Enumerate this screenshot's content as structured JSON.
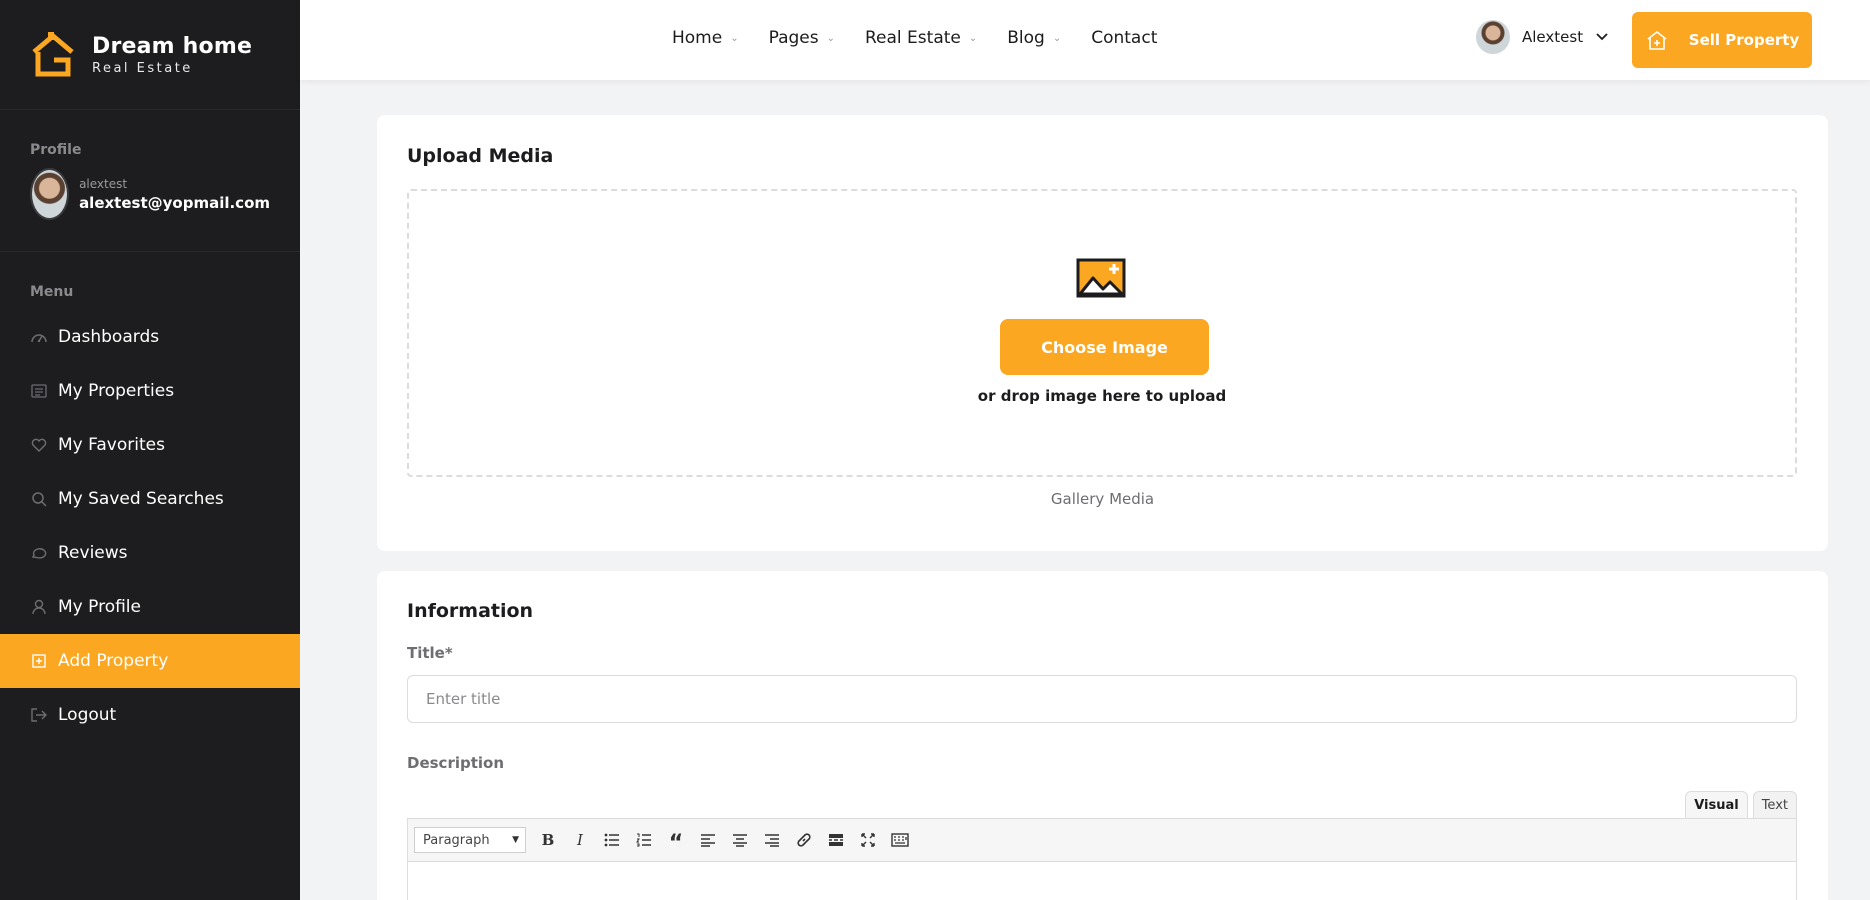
{
  "brand": {
    "name": "Dream home",
    "tagline": "Real Estate"
  },
  "colors": {
    "accent": "#fca722",
    "sidebar_bg": "#1d1d1f",
    "page_bg": "#f2f3f5"
  },
  "sidebar": {
    "profile_label": "Profile",
    "username": "alextest",
    "email": "alextest@yopmail.com",
    "menu_label": "Menu",
    "items": [
      {
        "label": "Dashboards",
        "icon": "dashboard-icon"
      },
      {
        "label": "My Properties",
        "icon": "list-icon"
      },
      {
        "label": "My Favorites",
        "icon": "heart-icon"
      },
      {
        "label": "My Saved Searches",
        "icon": "search-icon"
      },
      {
        "label": "Reviews",
        "icon": "chat-icon"
      },
      {
        "label": "My Profile",
        "icon": "user-icon"
      },
      {
        "label": "Add Property",
        "icon": "plus-square-icon",
        "active": true
      },
      {
        "label": "Logout",
        "icon": "logout-icon"
      }
    ]
  },
  "header": {
    "nav": [
      {
        "label": "Home",
        "has_dropdown": true
      },
      {
        "label": "Pages",
        "has_dropdown": true
      },
      {
        "label": "Real Estate",
        "has_dropdown": true
      },
      {
        "label": "Blog",
        "has_dropdown": true
      },
      {
        "label": "Contact",
        "has_dropdown": false
      }
    ],
    "user_name": "Alextest",
    "sell_label": "Sell Property"
  },
  "upload": {
    "title": "Upload Media",
    "choose_label": "Choose Image",
    "drop_hint": "or drop image here to upload",
    "gallery_label": "Gallery Media"
  },
  "info": {
    "title": "Information",
    "title_label": "Title*",
    "title_placeholder": "Enter title",
    "title_value": "",
    "description_label": "Description",
    "editor_tabs": [
      "Visual",
      "Text"
    ],
    "active_editor_tab": "Visual",
    "format_select": "Paragraph",
    "toolbar_icons": [
      "bold-icon",
      "italic-icon",
      "bullet-list-icon",
      "numbered-list-icon",
      "blockquote-icon",
      "align-left-icon",
      "align-center-icon",
      "align-right-icon",
      "link-icon",
      "read-more-icon",
      "fullscreen-icon",
      "keyboard-icon"
    ]
  }
}
